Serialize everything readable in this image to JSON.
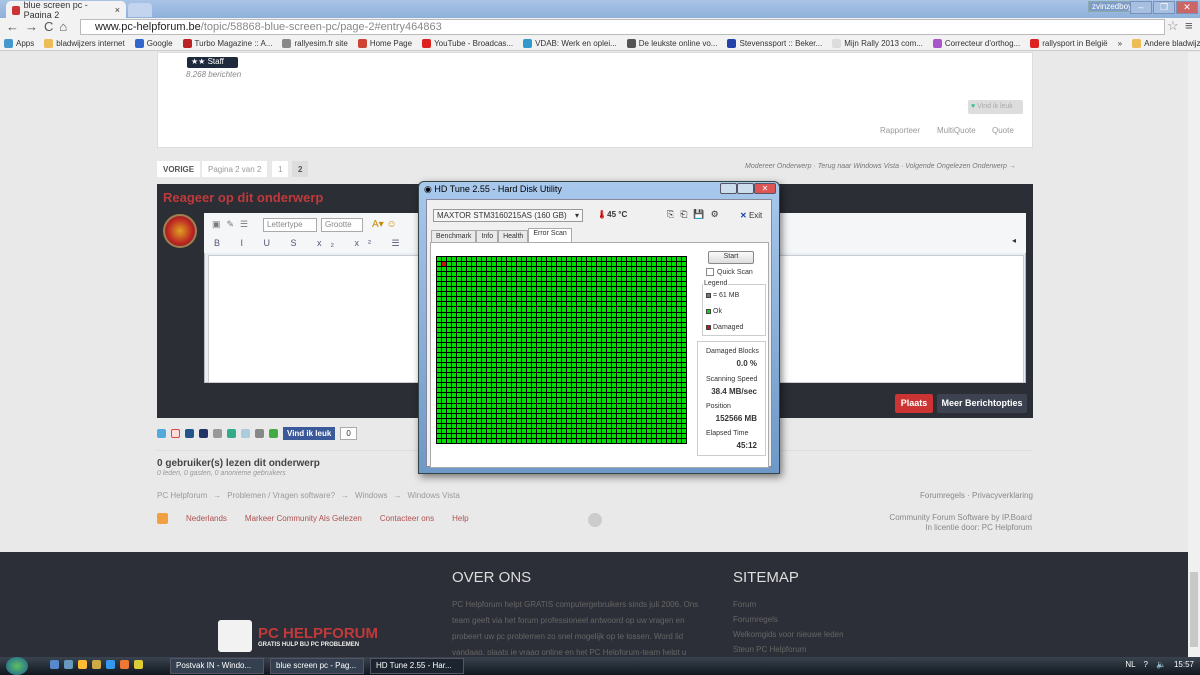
{
  "browser": {
    "tab_title": "blue screen pc - Pagina 2",
    "tab_close": "×",
    "user": "zvinzedboys",
    "min": "–",
    "max": "❐",
    "close": "✕",
    "url_domain": "www.pc-helpforum.be",
    "url_path": "/topic/58868-blue-screen-pc/page-2#entry464863",
    "bookmarks": [
      "Apps",
      "bladwijzers internet",
      "Google",
      "Turbo Magazine :: A...",
      "rallyesim.fr site",
      "Home Page",
      "YouTube - Broadcas...",
      "VDAB: Werk en oplei...",
      "De leukste online vo...",
      "Stevenssport :: Beker...",
      "Mijn Rally 2013 com...",
      "Correcteur d'orthog...",
      "rallysport in België"
    ],
    "more": "»",
    "other_bookmarks": "Andere bladwijzers"
  },
  "post": {
    "rank": "★★  Staff",
    "posts": "8.268 berichten",
    "like": "Vind ik leuk",
    "actions": [
      "Rapporteer",
      "MultiQuote",
      "Quote"
    ]
  },
  "pagination": {
    "prev": "VORIGE",
    "info": "Pagina 2 van 2",
    "pages": [
      "1",
      "2"
    ]
  },
  "modline": "Modereer Onderwerp · Terug naar Windows Vista · Volgende Ongelezen Onderwerp →",
  "reply": {
    "title": "Reageer op dit onderwerp",
    "font": "Lettertype",
    "size": "Grootte",
    "row2": "B I U S x₂ x² ☰ ☰ ❝ ◈ ▣ ‹›",
    "post": "Plaats",
    "more": "Meer Berichtopties"
  },
  "share": {
    "fb": "Vind ik leuk",
    "count": "0"
  },
  "readers": {
    "title": "0 gebruiker(s) lezen dit onderwerp",
    "sub": "0 leden, 0 gasten, 0 anonieme gebruikers"
  },
  "breadcrumb": [
    "PC Helpforum",
    "→",
    "Problemen / Vragen software?",
    "→",
    "Windows",
    "→",
    "Windows Vista"
  ],
  "footer_links": [
    "Nederlands",
    "Markeer Community Als Gelezen",
    "Contacteer ons",
    "Help"
  ],
  "rules": "Forumregels · Privacyverklaring",
  "ipb": [
    "Community Forum Software by IP.Board",
    "In licentie door: PC Helpforum"
  ],
  "footer": {
    "logo": "PC HELPFORUM",
    "logo_sub": "GRATIS HULP BIJ PC PROBLEMEN",
    "over_title": "OVER ONS",
    "over_text": "PC Helpforum helpt GRATIS computergebruikers sinds juli 2006. Ons team geeft via het forum professioneel antwoord op uw vragen en probeert uw pc problemen zo snel mogelijk op te lossen. Word lid vandaag, plaats je vraag online en het PC Helpforum-team helpt u",
    "sitemap_title": "SITEMAP",
    "sitemap": [
      "Forum",
      "Forumregels",
      "Welkomgids voor nieuwe leden",
      "Steun PC Helpforum"
    ]
  },
  "hdtune": {
    "title": "HD Tune 2.55 - Hard Disk Utility",
    "drive": "MAXTOR STM3160215AS (160 GB)",
    "temp": "45 °C",
    "exit": "Exit",
    "tabs": [
      "Benchmark",
      "Info",
      "Health",
      "Error Scan"
    ],
    "start": "Start",
    "quick_scan": "Quick Scan",
    "legend_title": "Legend",
    "legend": [
      "= 61 MB",
      "Ok",
      "Damaged"
    ],
    "stats": [
      {
        "label": "Damaged Blocks",
        "value": "0.0 %"
      },
      {
        "label": "Scanning Speed",
        "value": "38.4 MB/sec"
      },
      {
        "label": "Position",
        "value": "152566 MB"
      },
      {
        "label": "Elapsed Time",
        "value": "45:12"
      }
    ],
    "colors": {
      "ok": "#00dd00",
      "damaged": "#cc1111"
    }
  },
  "taskbar": {
    "items": [
      "Postvak IN - Windo...",
      "blue screen pc - Pag...",
      "HD Tune 2.55 - Har..."
    ],
    "lang": "NL",
    "time": "15:57"
  }
}
